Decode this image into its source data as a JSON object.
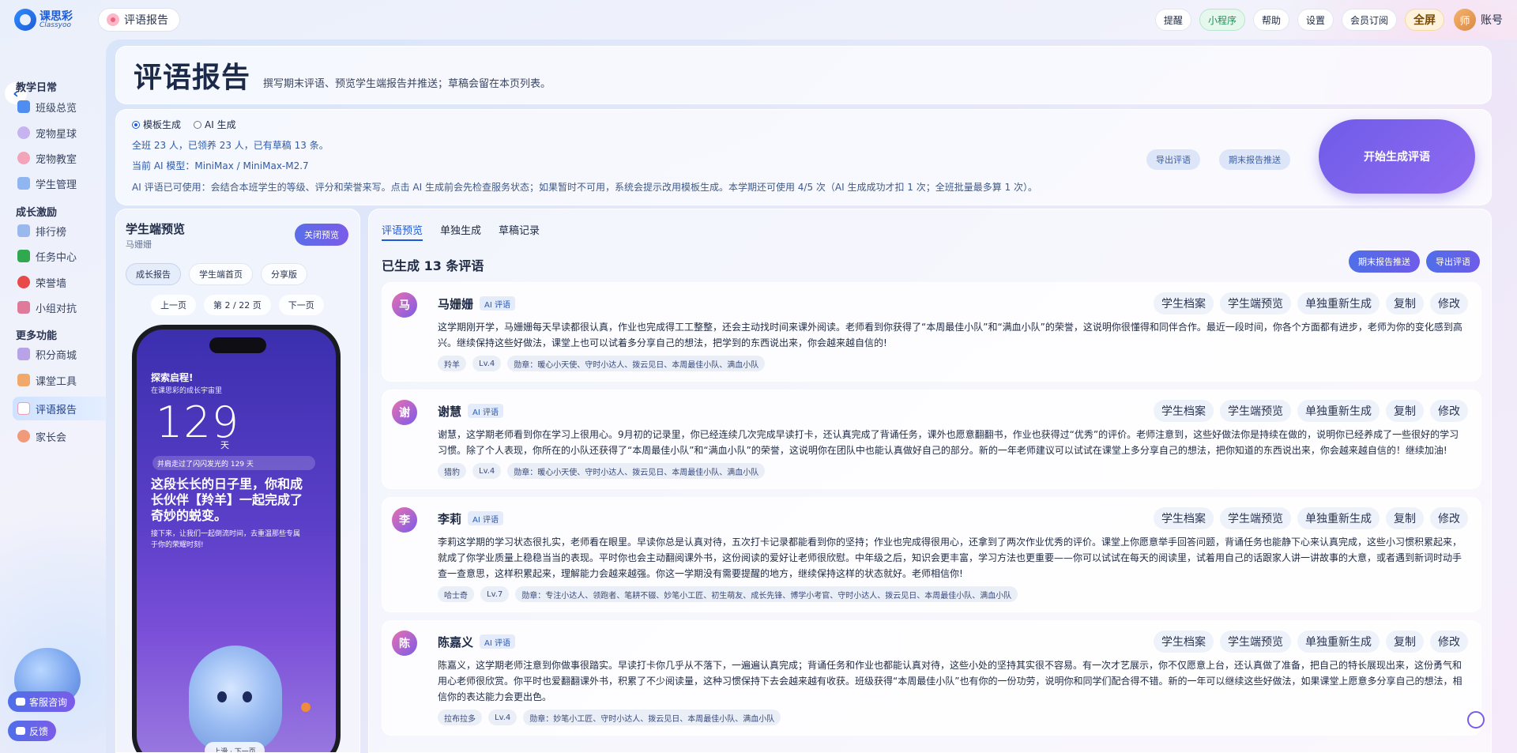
{
  "app": {
    "logo_cn": "课思彩",
    "logo_en": "Classyoo",
    "title_chip": "评语报告"
  },
  "topbar": {
    "buttons": [
      "提醒",
      "小程序",
      "帮助",
      "设置",
      "会员订阅"
    ],
    "fullscreen": "全屏",
    "avatar_char": "师",
    "account": "账号"
  },
  "sidebar": {
    "groups": [
      "教学日常",
      "成长激励",
      "更多功能"
    ],
    "items": [
      "班级总览",
      "宠物星球",
      "宠物教室",
      "学生管理",
      "排行榜",
      "任务中心",
      "荣誉墙",
      "小组对抗",
      "积分商城",
      "课堂工具",
      "评语报告",
      "家长会"
    ],
    "float_buttons": [
      "客服咨询",
      "反馈"
    ]
  },
  "header": {
    "title": "评语报告",
    "subtitle": "撰写期末评语、预览学生端报告并推送；草稿会留在本页列表。"
  },
  "generate": {
    "radio_template": "模板生成",
    "radio_ai": "AI 生成",
    "summary": "全班 23 人，已领养 23 人，已有草稿 13 条。",
    "model": "当前 AI 模型：MiniMax / MiniMax-M2.7",
    "desc": "AI 评语已可使用：会结合本班学生的等级、评分和荣誉来写。点击 AI 生成前会先检查服务状态；如果暂时不可用，系统会提示改用模板生成。本学期还可使用 4/5 次（AI 生成成功才扣 1 次；全班批量最多算 1 次）。",
    "export_btn": "导出评语",
    "push_btn": "期末报告推送",
    "start_btn": "开始生成评语"
  },
  "preview": {
    "title": "学生端预览",
    "student": "马姗姗",
    "close_btn": "关闭预览",
    "tabs": [
      "成长报告",
      "学生端首页",
      "分享版"
    ],
    "prev": "上一页",
    "page": "第 2 / 22 页",
    "next": "下一页",
    "screen": {
      "heading": "探索启程!",
      "sub": "在课思彩的成长宇宙里",
      "days": "129",
      "unit": "天",
      "pill": "并肩走过了闪闪发光的 129 天",
      "big": "这段长长的日子里，你和成长伙伴【羚羊】一起完成了奇妙的蜕变。",
      "small": "接下来，让我们一起倒流时间，去重温那些专属于你的荣耀时刻!",
      "nav": "上滑 · 下一页"
    }
  },
  "list": {
    "tabs": [
      "评语预览",
      "单独生成",
      "草稿记录"
    ],
    "count_title": "已生成 13 条评语",
    "push_btn": "期末报告推送",
    "export_btn": "导出评语",
    "ai_tag": "AI 评语",
    "card_buttons": [
      "学生档案",
      "学生端预览",
      "单独重新生成",
      "复制",
      "修改"
    ],
    "cards": [
      {
        "avatar": "马",
        "name": "马姗姗",
        "text": "这学期刚开学，马姗姗每天早读都很认真，作业也完成得工工整整，还会主动找时间来课外阅读。老师看到你获得了“本周最佳小队”和“满血小队”的荣誉，这说明你很懂得和同伴合作。最近一段时间，你各个方面都有进步，老师为你的变化感到高兴。继续保持这些好做法，课堂上也可以试着多分享自己的想法，把学到的东西说出来，你会越来越自信的!",
        "chips": [
          "羚羊",
          "Lv.4",
          "勋章：暖心小天使、守时小达人、拨云见日、本周最佳小队、满血小队"
        ]
      },
      {
        "avatar": "谢",
        "name": "谢慧",
        "text": "谢慧，这学期老师看到你在学习上很用心。9月初的记录里，你已经连续几次完成早读打卡，还认真完成了背诵任务，课外也愿意翻翻书，作业也获得过“优秀”的评价。老师注意到，这些好做法你是持续在做的，说明你已经养成了一些很好的学习习惯。除了个人表现，你所在的小队还获得了“本周最佳小队”和“满血小队”的荣誉，这说明你在团队中也能认真做好自己的部分。新的一年老师建议可以试试在课堂上多分享自己的想法，把你知道的东西说出来，你会越来越自信的！继续加油!",
        "chips": [
          "猎豹",
          "Lv.4",
          "勋章：暖心小天使、守时小达人、拨云见日、本周最佳小队、满血小队"
        ]
      },
      {
        "avatar": "李",
        "name": "李莉",
        "text": "李莉这学期的学习状态很扎实，老师看在眼里。早读你总是认真对待，五次打卡记录都能看到你的坚持；作业也完成得很用心，还拿到了两次作业优秀的评价。课堂上你愿意举手回答问题，背诵任务也能静下心来认真完成，这些小习惯积累起来，就成了你学业质量上稳稳当当的表现。平时你也会主动翻阅课外书，这份阅读的爱好让老师很欣慰。中年级之后，知识会更丰富，学习方法也更重要——你可以试试在每天的阅读里，试着用自己的话跟家人讲一讲故事的大意，或者遇到新词时动手查一查意思，这样积累起来，理解能力会越来越强。你这一学期没有需要提醒的地方，继续保持这样的状态就好。老师相信你!",
        "chips": [
          "哈士奇",
          "Lv.7",
          "勋章：专注小达人、领跑者、笔耕不辍、妙笔小工匠、初生萌友、成长先锋、博学小考官、守时小达人、拨云见日、本周最佳小队、满血小队"
        ]
      },
      {
        "avatar": "陈",
        "name": "陈嘉义",
        "text": "陈嘉义，这学期老师注意到你做事很踏实。早读打卡你几乎从不落下，一遍遍认真完成；背诵任务和作业也都能认真对待，这些小处的坚持其实很不容易。有一次才艺展示，你不仅愿意上台，还认真做了准备，把自己的特长展现出来，这份勇气和用心老师很欣赏。你平时也爱翻翻课外书，积累了不少阅读量，这种习惯保持下去会越来越有收获。班级获得“本周最佳小队”也有你的一份功劳，说明你和同学们配合得不错。新的一年可以继续这些好做法，如果课堂上愿意多分享自己的想法，相信你的表达能力会更出色。",
        "chips": [
          "拉布拉多",
          "Lv.4",
          "勋章：妙笔小工匠、守时小达人、拨云见日、本周最佳小队、满血小队"
        ]
      }
    ]
  }
}
